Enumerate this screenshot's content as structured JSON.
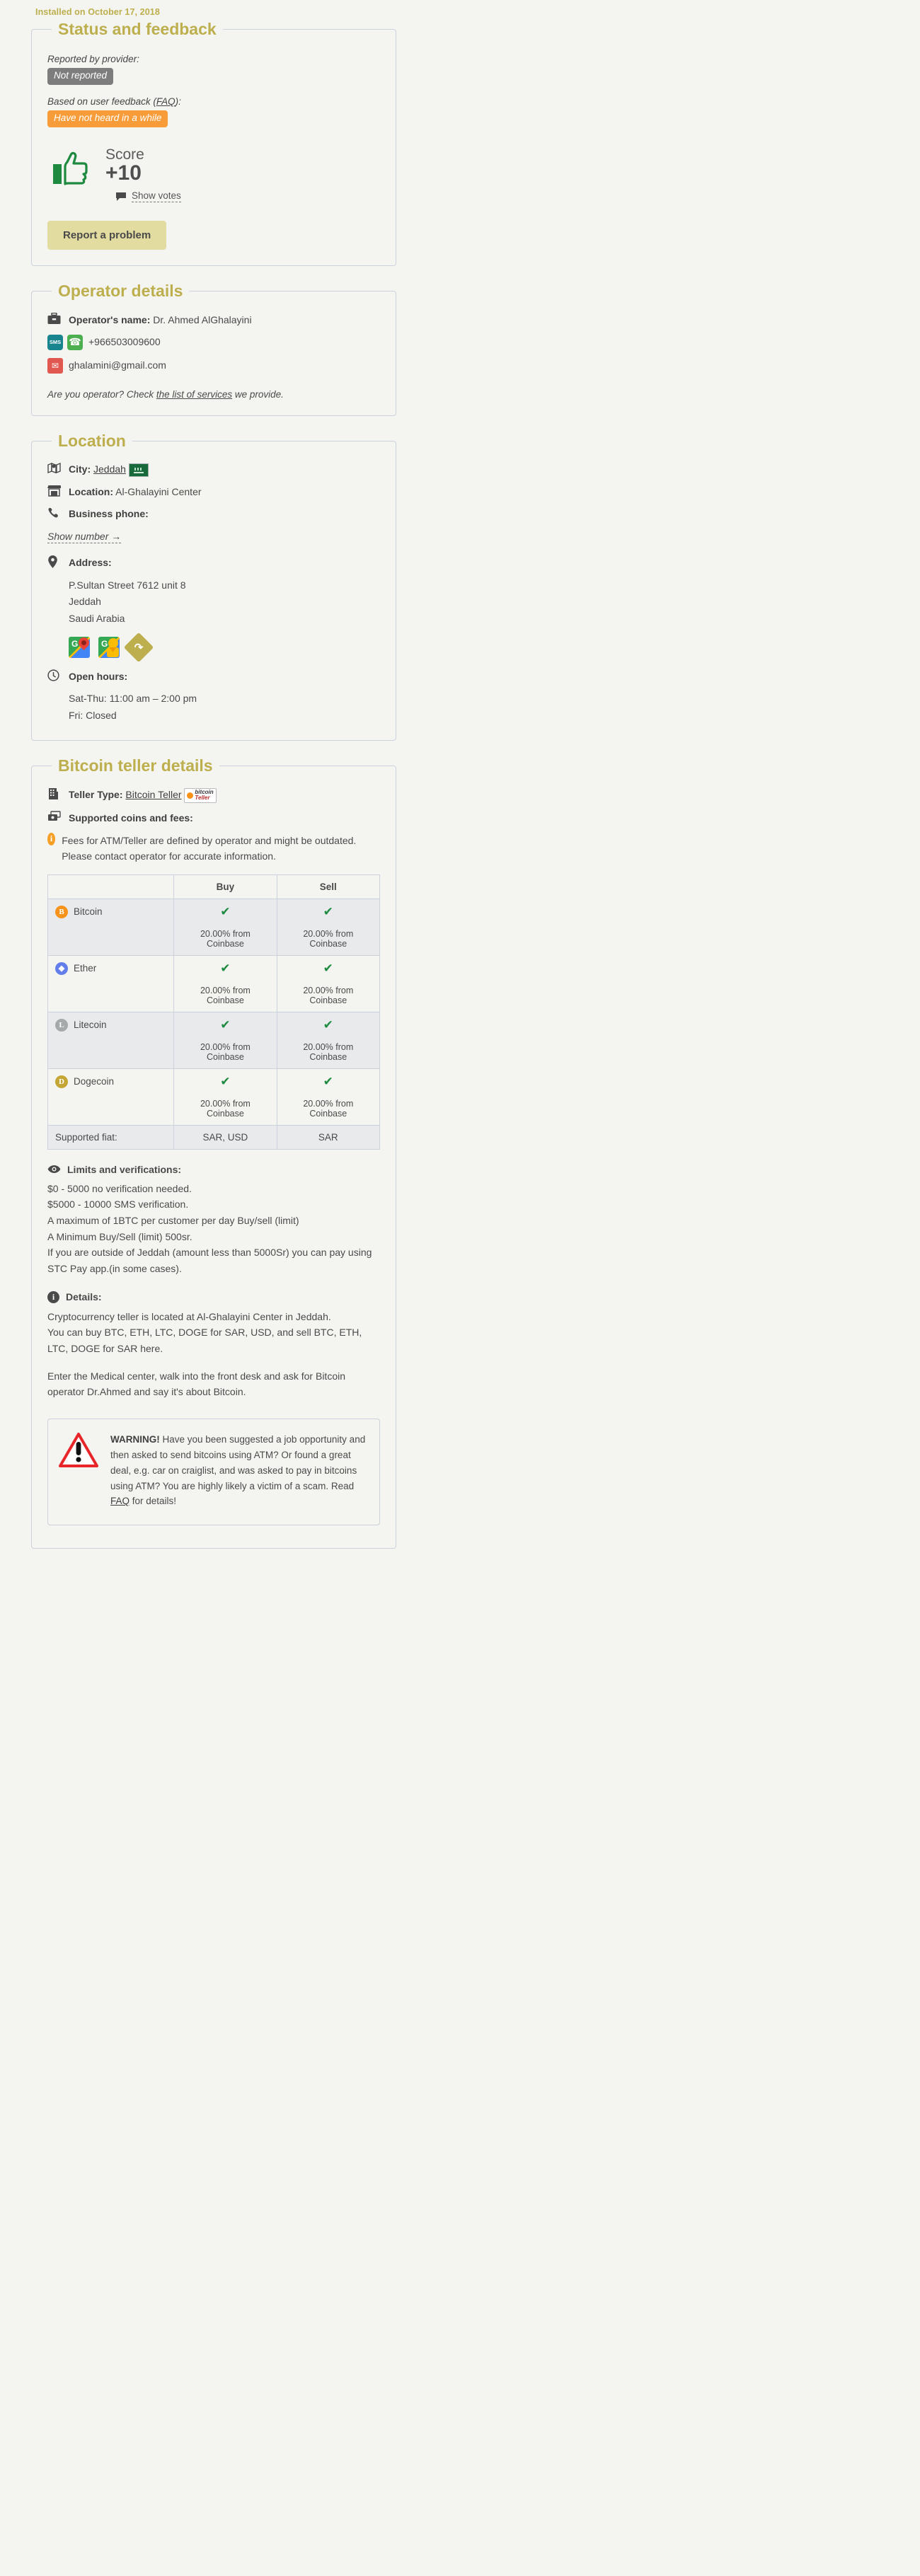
{
  "installed": "Installed on October 17, 2018",
  "status": {
    "title": "Status and feedback",
    "reported_label": "Reported by provider:",
    "reported_badge": "Not reported",
    "feedback_label_pre": "Based on user feedback (",
    "feedback_faq": "FAQ",
    "feedback_label_post": "):",
    "feedback_badge": "Have not heard in a while",
    "score_label": "Score",
    "score_value": "+10",
    "show_votes": "Show votes",
    "report_button": "Report a problem"
  },
  "operator": {
    "title": "Operator details",
    "name_label": "Operator's name:",
    "name_value": "Dr. Ahmed AlGhalayini",
    "phone": "+966503009600",
    "email": "ghalamini@gmail.com",
    "note_pre": "Are you operator? Check ",
    "note_link": "the list of services",
    "note_post": " we provide."
  },
  "location": {
    "title": "Location",
    "city_label": "City:",
    "city_value": "Jeddah",
    "location_label": "Location:",
    "location_value": "Al-Ghalayini Center",
    "business_phone_label": "Business phone:",
    "show_number": "Show number →",
    "address_label": "Address:",
    "address_lines": [
      "P.Sultan Street 7612 unit 8",
      "Jeddah",
      "Saudi Arabia"
    ],
    "open_hours_label": "Open hours:",
    "open_hours_lines": [
      "Sat-Thu: 11:00 am – 2:00 pm",
      "Fri: Closed"
    ]
  },
  "teller": {
    "title": "Bitcoin teller details",
    "teller_type_label": "Teller Type:",
    "teller_type_value": "Bitcoin Teller",
    "teller_logo_line1": "bitcoin",
    "teller_logo_line2": "Teller",
    "supported_label": "Supported coins and fees:",
    "fees_notice": "Fees for ATM/Teller are defined by operator and might be outdated. Please contact operator for accurate information.",
    "table": {
      "headers": [
        "",
        "Buy",
        "Sell"
      ],
      "rows": [
        {
          "coin": "Bitcoin",
          "icon": "bitcoin-icon",
          "buy_check": "✔",
          "buy_fee": "20.00% from Coinbase",
          "sell_check": "✔",
          "sell_fee": "20.00% from Coinbase"
        },
        {
          "coin": "Ether",
          "icon": "ether-icon",
          "buy_check": "✔",
          "buy_fee": "20.00% from Coinbase",
          "sell_check": "✔",
          "sell_fee": "20.00% from Coinbase"
        },
        {
          "coin": "Litecoin",
          "icon": "litecoin-icon",
          "buy_check": "✔",
          "buy_fee": "20.00% from Coinbase",
          "sell_check": "✔",
          "sell_fee": "20.00% from Coinbase"
        },
        {
          "coin": "Dogecoin",
          "icon": "dogecoin-icon",
          "buy_check": "✔",
          "buy_fee": "20.00% from Coinbase",
          "sell_check": "✔",
          "sell_fee": "20.00% from Coinbase"
        }
      ],
      "fiat_label": "Supported fiat:",
      "fiat_buy": "SAR, USD",
      "fiat_sell": "SAR"
    },
    "limits_label": "Limits and verifications:",
    "limits_lines": [
      "$0 - 5000 no verification needed.",
      "$5000 - 10000 SMS verification.",
      "A maximum of 1BTC per customer per day Buy/sell (limit)",
      "A Minimum Buy/Sell (limit) 500sr.",
      "If you are outside of Jeddah (amount less than 5000Sr) you can pay using STC Pay app.(in some cases)."
    ],
    "details_label": "Details:",
    "details_paragraph1": [
      "Cryptocurrency teller is located at Al-Ghalayini Center in Jeddah.",
      "You can buy BTC, ETH, LTC, DOGE for SAR, USD, and sell BTC, ETH, LTC, DOGE for SAR here."
    ],
    "details_paragraph2": "Enter the Medical center, walk into the front desk and ask for Bitcoin operator Dr.Ahmed and say it's about Bitcoin."
  },
  "warning": {
    "bold": "WARNING!",
    "text_pre": " Have you been suggested a job opportunity and then asked to send bitcoins using ATM? Or found a great deal, e.g. car on craiglist, and was asked to pay in bitcoins using ATM? You are highly likely a victim of a scam. Read ",
    "link": "FAQ",
    "text_post": " for details!"
  },
  "colors": {
    "accent": "#bdae4e",
    "orange_badge": "#f79c38",
    "grey_badge": "#7d7d7d",
    "green_check": "#1d8a3f",
    "page_bg": "#f4f5f0"
  }
}
